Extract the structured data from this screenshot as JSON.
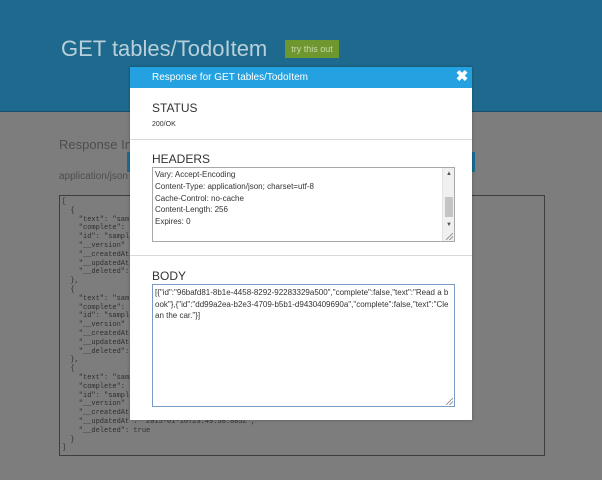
{
  "page": {
    "title": "GET tables/TodoItem",
    "try_button": "try this out",
    "response_section": "Response Inf",
    "content_type": "application/json",
    "json_preview": "[\n  {\n    \"text\": \"sam\n    \"complete\": \n    \"id\": \"sampl\n    \"__version\"\n    \"__createdAt\n    \"__updatedAt\n    \"__deleted\":\n  },\n  {\n    \"text\": \"sam\n    \"complete\": \n    \"id\": \"sampl\n    \"__version\"\n    \"__createdAt\n    \"__updatedAt\n    \"__deleted\":\n  },\n  {\n    \"text\": \"samp\n    \"complete\": t\n    \"id\": \"sampl\n    \"__version\"\n    \"__createdAt\"\n    \"__updatedAt\": \"2015-01-10T23:49:58.885Z\",\n    \"__deleted\": true\n  }\n]"
  },
  "modal": {
    "title": "Response for GET tables/TodoItem",
    "close_glyph": "✖",
    "status": {
      "heading": "STATUS",
      "value": "200/OK"
    },
    "headers": {
      "heading": "HEADERS",
      "lines": [
        "Vary: Accept-Encoding",
        "Content-Type: application/json; charset=utf-8",
        "Cache-Control: no-cache",
        "Content-Length: 256",
        "Expires: 0"
      ]
    },
    "body": {
      "heading": "BODY",
      "value": "[{\"id\":\"96bafd81-8b1e-4458-8292-92283329a500\",\"complete\":false,\"text\":\"Read a book\"},{\"id\":\"dd99a2ea-b2e3-4709-b5b1-d9430409690a\",\"complete\":false,\"text\":\"Clean the car.\"}]"
    }
  },
  "colors": {
    "header_bg": "#1e6a8e",
    "modal_title_bg": "#24a1e0",
    "try_button_bg": "#6f9730"
  }
}
